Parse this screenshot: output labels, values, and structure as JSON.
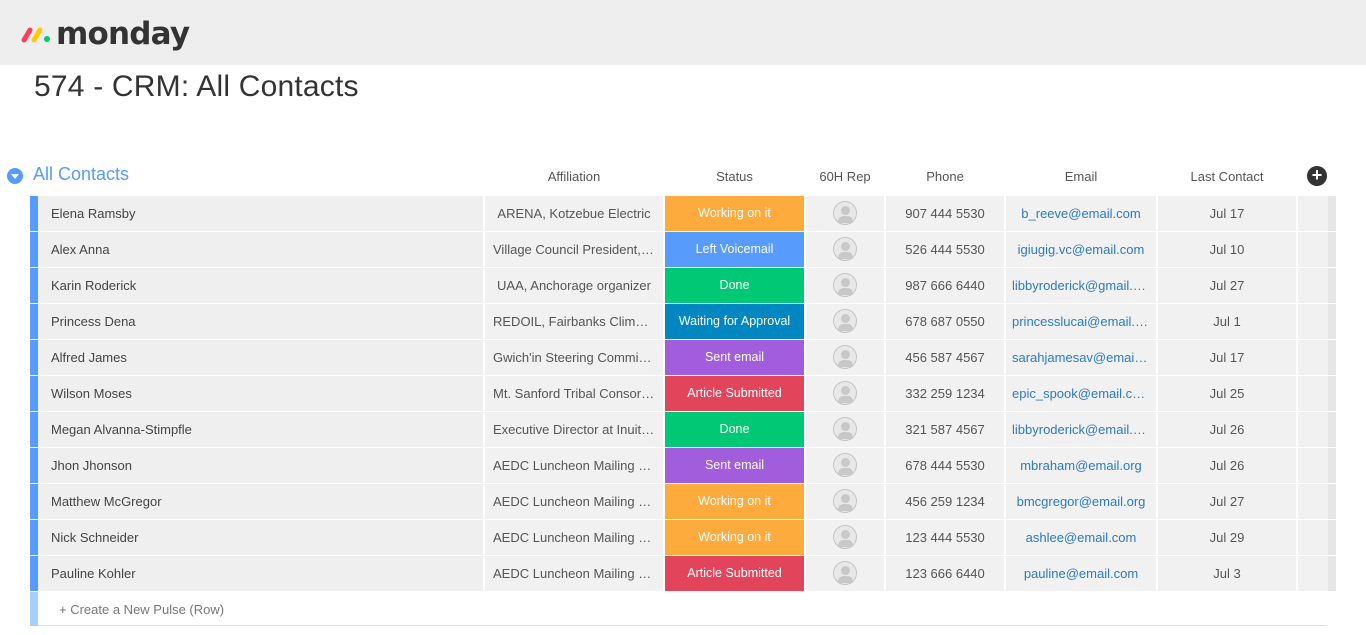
{
  "app": {
    "logo_text": "monday",
    "logo_colors": [
      "#ff3d57",
      "#ffcb00",
      "#00ca72"
    ]
  },
  "page": {
    "title": "574 - CRM: All Contacts"
  },
  "group": {
    "title": "All Contacts",
    "color": "#579bfc"
  },
  "columns": {
    "affiliation": "Affiliation",
    "status": "Status",
    "rep": "60H Rep",
    "phone": "Phone",
    "email": "Email",
    "last_contact": "Last Contact"
  },
  "add_column_icon": "plus-circle-icon",
  "status_colors": {
    "Working on it": "#fdab3d",
    "Left Voicemail": "#579bfc",
    "Done": "#00c875",
    "Waiting for Approval": "#0086c0",
    "Sent email": "#a25ddc",
    "Article Submitted": "#e2445c"
  },
  "rows": [
    {
      "name": "Elena Ramsby",
      "affiliation": "ARENA, Kotzebue Electric",
      "status": "Working on it",
      "phone": "907 444 5530",
      "email": "b_reeve@email.com",
      "last_contact": "Jul 17"
    },
    {
      "name": "Alex Anna",
      "affiliation": "Village Council President, V...",
      "status": "Left Voicemail",
      "phone": "526 444 5530",
      "email": "igiugig.vc@email.com",
      "last_contact": "Jul 10"
    },
    {
      "name": "Karin Roderick",
      "affiliation": "UAA, Anchorage organizer",
      "status": "Done",
      "phone": "987 666 6440",
      "email": "libbyroderick@gmail.c...",
      "last_contact": "Jul 27"
    },
    {
      "name": "Princess Dena",
      "affiliation": "REDOIL, Fairbanks Climate ...",
      "status": "Waiting for Approval",
      "phone": "678 687 0550",
      "email": "princesslucai@email.c...",
      "last_contact": "Jul 1"
    },
    {
      "name": "Alfred James",
      "affiliation": "Gwich'in Steering Committ...",
      "status": "Sent email",
      "phone": "456 587 4567",
      "email": "sarahjamesav@email....",
      "last_contact": "Jul 17"
    },
    {
      "name": "Wilson Moses",
      "affiliation": "Mt. Sanford Tribal Consorti...",
      "status": "Article Submitted",
      "phone": "332 259 1234",
      "email": "epic_spook@email.com",
      "last_contact": "Jul 25"
    },
    {
      "name": "Megan Alvanna-Stimpfle",
      "affiliation": "Executive Director at Inuit ...",
      "status": "Done",
      "phone": "321 587 4567",
      "email": "libbyroderick@email.c...",
      "last_contact": "Jul 26"
    },
    {
      "name": "Jhon Jhonson",
      "affiliation": "AEDC Luncheon Mailing List",
      "status": "Sent email",
      "phone": "678 444 5530",
      "email": "mbraham@email.org",
      "last_contact": "Jul 26"
    },
    {
      "name": "Matthew McGregor",
      "affiliation": "AEDC Luncheon Mailing List",
      "status": "Working on it",
      "phone": "456 259 1234",
      "email": "bmcgregor@email.org",
      "last_contact": "Jul 27"
    },
    {
      "name": "Nick Schneider",
      "affiliation": "AEDC Luncheon Mailing List",
      "status": "Working on it",
      "phone": "123 444 5530",
      "email": "ashlee@email.com",
      "last_contact": "Jul 29"
    },
    {
      "name": "Pauline Kohler",
      "affiliation": "AEDC Luncheon Mailing List",
      "status": "Article Submitted",
      "phone": "123 666 6440",
      "email": "pauline@email.com",
      "last_contact": "Jul 3"
    }
  ],
  "new_row_label": "+ Create a New Pulse (Row)"
}
